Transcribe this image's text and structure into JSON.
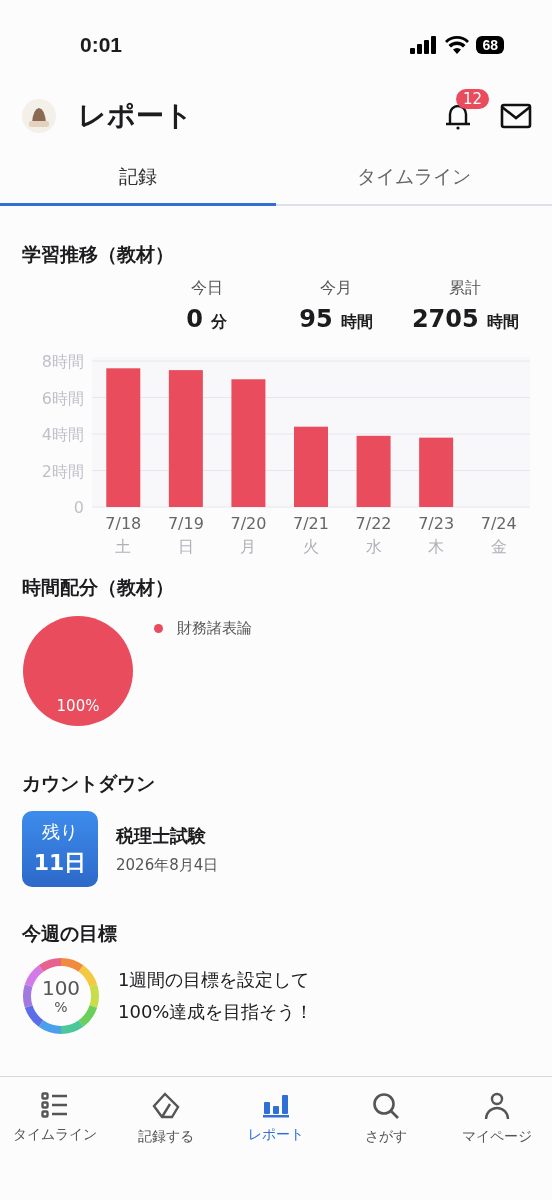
{
  "status_bar": {
    "time": "0:01",
    "battery": "68"
  },
  "header": {
    "title": "レポート",
    "notification_count": "12"
  },
  "tabs": [
    {
      "label": "記録",
      "selected": true
    },
    {
      "label": "タイムライン",
      "selected": false
    }
  ],
  "study_trend": {
    "title": "学習推移（教材）",
    "weekday_labels": [
      "土",
      "日",
      "月",
      "火",
      "水",
      "木",
      "金"
    ],
    "stats": [
      {
        "label": "今日",
        "value": "0",
        "unit": "分"
      },
      {
        "label": "今月",
        "value": "95",
        "unit": "時間"
      },
      {
        "label": "累計",
        "value": "2705",
        "unit": "時間"
      }
    ],
    "chart_data": {
      "type": "bar",
      "categories": [
        "7/18",
        "7/19",
        "7/20",
        "7/21",
        "7/22",
        "7/23",
        "7/24"
      ],
      "series": [
        {
          "color": "#e94c5c",
          "values": [
            7.6,
            7.5,
            7.0,
            4.4,
            3.9,
            3.8,
            null
          ]
        }
      ],
      "ylim": [
        0,
        8
      ],
      "grid": true,
      "yticks": [
        {
          "value": 0,
          "label": "0"
        },
        {
          "value": 2,
          "label": "2時間"
        },
        {
          "value": 4,
          "label": "4時間"
        },
        {
          "value": 6,
          "label": "6時間"
        },
        {
          "value": 8,
          "label": "8時間"
        }
      ]
    }
  },
  "time_share": {
    "title": "時間配分（教材）",
    "chart_data": {
      "type": "pie",
      "categories": [
        "財務諸表論"
      ],
      "series": [
        {
          "color": "#e94c5c",
          "values": [
            100
          ]
        }
      ],
      "value_labels": [
        "100%"
      ]
    }
  },
  "countdown": {
    "title": "カウントダウン",
    "remaining_label": "残り",
    "remaining_days": "11日",
    "exam": "税理士試験",
    "date": "2026年8月4日"
  },
  "weekly_goal": {
    "title": "今週の目標",
    "percent": "100",
    "percent_unit": "%",
    "lines": [
      "1週間の目標を設定して",
      "100%達成を目指そう！"
    ]
  },
  "bottom_nav": [
    {
      "label": "タイムライン",
      "selected": false
    },
    {
      "label": "記録する",
      "selected": false
    },
    {
      "label": "レポート",
      "selected": true
    },
    {
      "label": "さがす",
      "selected": false
    },
    {
      "label": "マイページ",
      "selected": false
    }
  ]
}
